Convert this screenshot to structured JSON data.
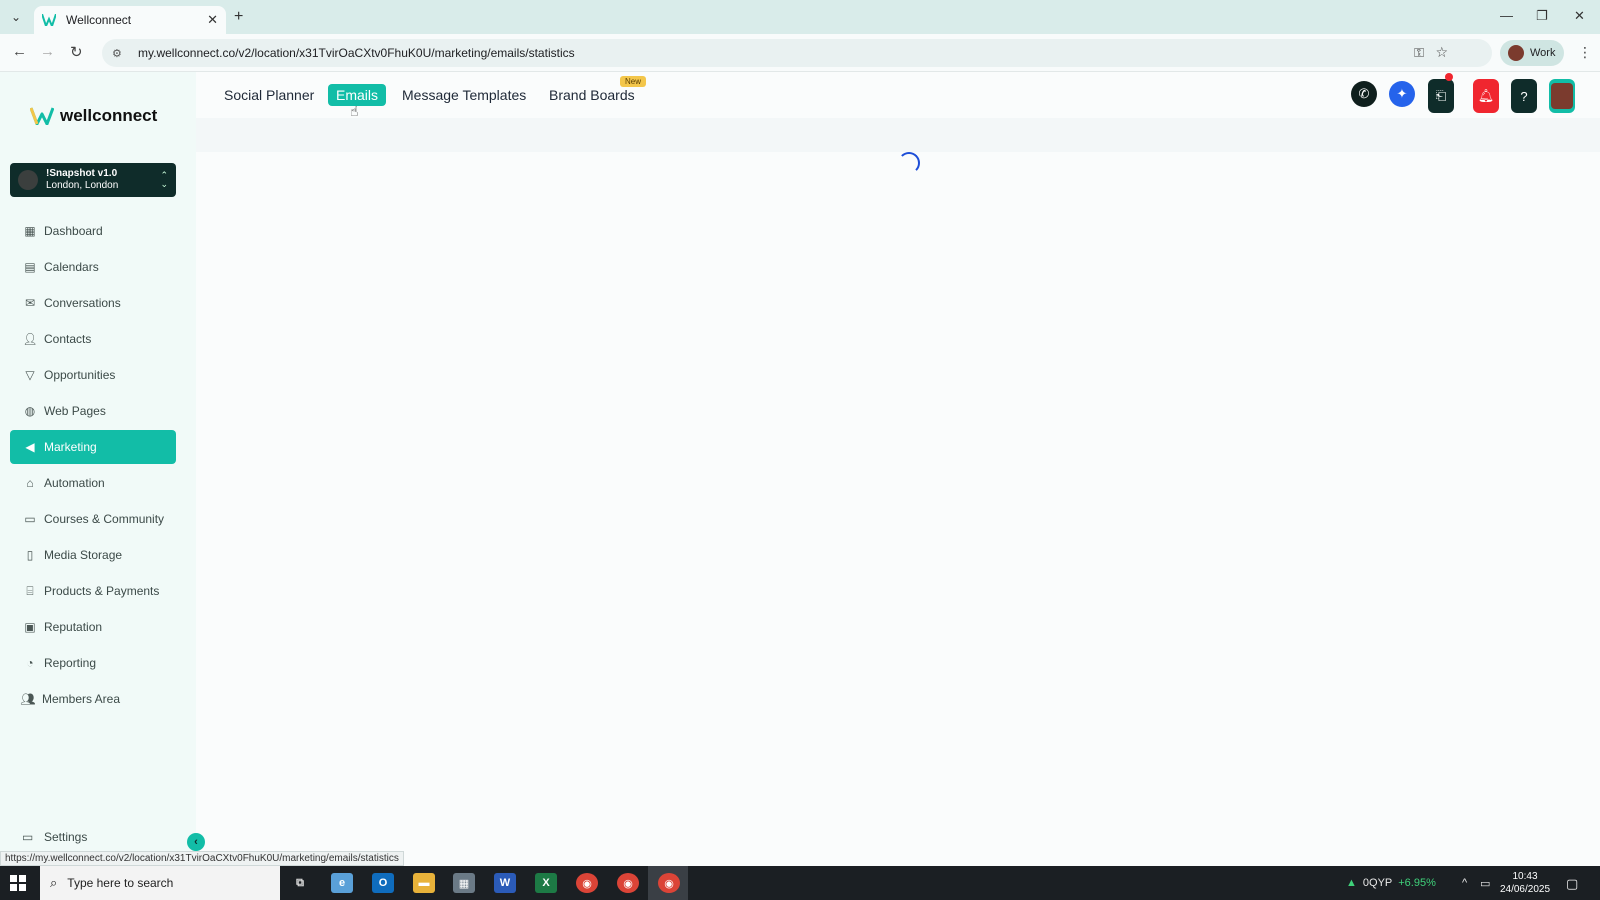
{
  "browser": {
    "tab_title": "Wellconnect",
    "url": "my.wellconnect.co/v2/location/x31TvirOaCXtv0FhuK0U/marketing/emails/statistics",
    "profile_label": "Work",
    "status_url": "https://my.wellconnect.co/v2/location/x31TvirOaCXtv0FhuK0U/marketing/emails/statistics"
  },
  "sidebar": {
    "logo_text": "wellconnect",
    "account": {
      "name": "!Snapshot v1.0",
      "location": "London, London"
    },
    "items": [
      {
        "label": "Dashboard",
        "icon": "dashboard-icon"
      },
      {
        "label": "Calendars",
        "icon": "calendar-icon"
      },
      {
        "label": "Conversations",
        "icon": "inbox-icon"
      },
      {
        "label": "Contacts",
        "icon": "user-icon"
      },
      {
        "label": "Opportunities",
        "icon": "funnel-icon"
      },
      {
        "label": "Web Pages",
        "icon": "globe-icon"
      },
      {
        "label": "Marketing",
        "icon": "megaphone-icon",
        "active": true
      },
      {
        "label": "Automation",
        "icon": "robot-icon"
      },
      {
        "label": "Courses & Community",
        "icon": "monitor-icon"
      },
      {
        "label": "Media Storage",
        "icon": "file-icon"
      },
      {
        "label": "Products & Payments",
        "icon": "store-icon"
      },
      {
        "label": "Reputation",
        "icon": "star-card-icon"
      },
      {
        "label": "Reporting",
        "icon": "chart-icon"
      },
      {
        "label": "Members Area",
        "icon": "users-icon"
      }
    ],
    "settings_label": "Settings"
  },
  "topnav": {
    "tabs": [
      {
        "label": "Social Planner",
        "active": false
      },
      {
        "label": "Emails",
        "active": true
      },
      {
        "label": "Message Templates",
        "active": false
      },
      {
        "label": "Brand Boards",
        "active": false
      }
    ],
    "new_badge": "New"
  },
  "colors": {
    "accent": "#12bda7",
    "sidebar_bg": "#f1faf8",
    "account_bg": "#0f2c2a",
    "notification_red": "#f0262f",
    "launchpad_blue": "#2563eb"
  },
  "taskbar": {
    "search_placeholder": "Type here to search",
    "ticker_symbol": "0QYP",
    "ticker_change": "+6.95%",
    "time": "10:43",
    "date": "24/06/2025"
  }
}
